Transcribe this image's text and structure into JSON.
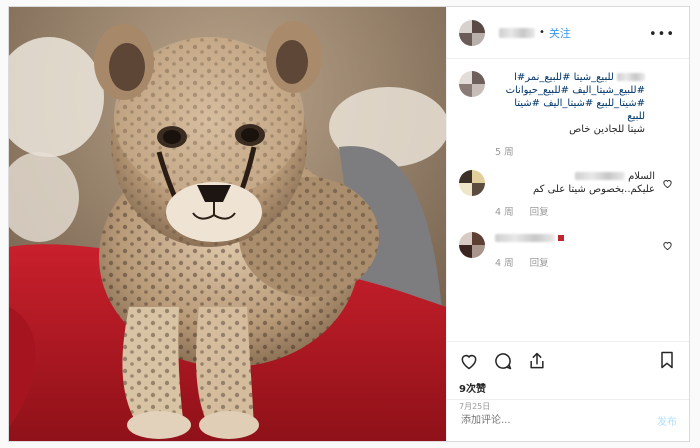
{
  "header": {
    "follow_label": "关注"
  },
  "caption": {
    "line1": "للبيع_شيتا #للبيع_نمر#ا",
    "line2": "#للبيع_شيتا_اليف #للبيع_حيوانات",
    "line3": "#شيتا_للبيع #شيتا_اليف #شيتا للبيع",
    "line4": "شيتا للجادين خاص",
    "time": "5 周"
  },
  "comments": [
    {
      "text_line1": "السلام",
      "text_line2": "عليكم..بخصوص شيتا على كم",
      "time": "4 周",
      "reply": "回复"
    },
    {
      "text_line1": "",
      "text_line2": "",
      "time": "4 周",
      "reply": "回复"
    }
  ],
  "actions": {
    "likes": "9次赞",
    "date": "7月25日"
  },
  "add_comment": {
    "placeholder": "添加评论...",
    "post_label": "发布"
  },
  "icons": [
    "more-icon",
    "heart-icon",
    "comment-icon",
    "share-icon",
    "bookmark-icon"
  ],
  "colors": {
    "link": "#3897f0",
    "muted": "#999999",
    "border": "#dbdbdb"
  }
}
